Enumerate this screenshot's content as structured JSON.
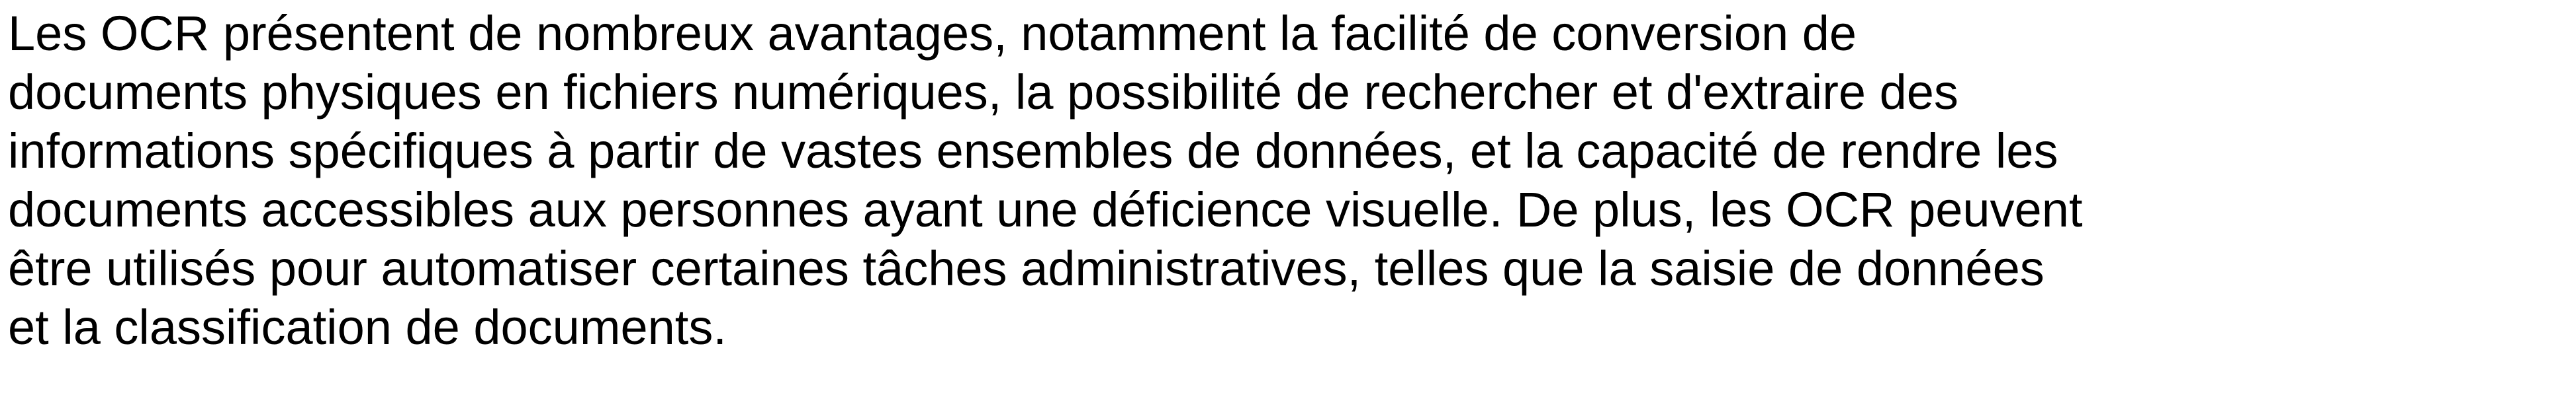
{
  "paragraph": {
    "lines": [
      "Les OCR présentent de nombreux avantages, notamment la facilité de conversion de",
      "documents physiques en fichiers numériques, la possibilité de rechercher et d'extraire des",
      "informations spécifiques à partir de vastes ensembles de données, et la capacité de rendre les",
      "documents accessibles aux personnes ayant une déficience visuelle. De plus, les OCR peuvent",
      "être utilisés pour automatiser certaines tâches administratives, telles que la saisie de données",
      "et la classification de documents."
    ]
  }
}
